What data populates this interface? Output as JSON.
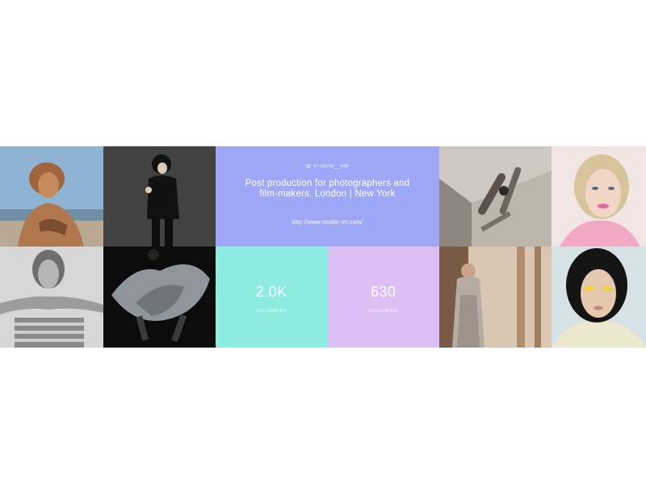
{
  "profile": {
    "handle": "@ STUDIO__RM",
    "bio": "Post production for photographers and film-makers. London | New York",
    "website": "http://www.studio-rm.com/"
  },
  "stats": {
    "followers": {
      "value": "2.0K",
      "label": "FOLLOWERS"
    },
    "following": {
      "value": "630",
      "label": "FOLLOWING"
    }
  },
  "colors": {
    "profile_bg": "#9fa8f7",
    "followers_bg": "#8cece0",
    "following_bg": "#dcbff5",
    "page_bg": "#ffffff"
  },
  "tiles": [
    {
      "name": "photo-beach-portrait"
    },
    {
      "name": "photo-man-in-black-suit"
    },
    {
      "name": "photo-bw-woman-portrait"
    },
    {
      "name": "photo-dancer-with-fabric"
    },
    {
      "name": "photo-still-life-objects"
    },
    {
      "name": "photo-blonde-portrait"
    },
    {
      "name": "photo-woman-in-dress-window"
    },
    {
      "name": "photo-woman-yellow-eyeshadow"
    }
  ]
}
